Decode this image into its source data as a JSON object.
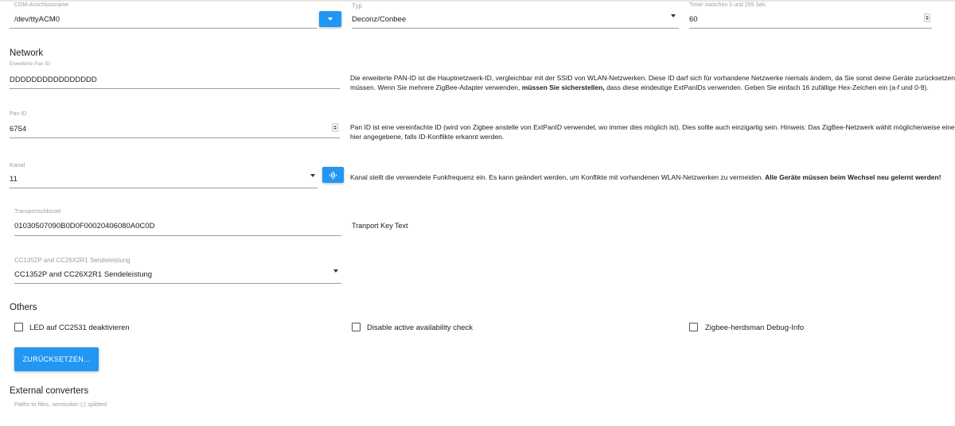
{
  "com_port": {
    "label": "COM-Anschlussname",
    "value": "/dev/ttyACM0"
  },
  "type": {
    "label": "Typ",
    "value": "Deconz/Conbee"
  },
  "timer": {
    "label": "Timer zwischen 0 und 255 Sek.",
    "value": "60"
  },
  "network": {
    "title": "Network",
    "ext_pan_id": {
      "label": "Erweiterte Pan ID",
      "value": "DDDDDDDDDDDDDDDD",
      "desc_line1": "Die erweiterte PAN-ID ist die Hauptnetzwerk-ID, vergleichbar mit der SSID von WLAN-Netzwerken. Diese ID darf sich für vorhandene Netzwerke niemals ändern, da Sie sonst deine Geräte zurücksetzen und",
      "desc_line2_pre": "müssen. Wenn Sie mehrere ZigBee-Adapter verwenden, ",
      "desc_line2_bold": "müssen Sie sicherstellen,",
      "desc_line2_post": " dass diese eindeutige ExtPanIDs verwenden. Geben Sie einfach 16 zufällige Hex-Zeichen ein (a-f und 0-9)."
    },
    "pan_id": {
      "label": "Pan ID",
      "value": "6754",
      "desc_line1": "Pan ID ist eine vereinfachte ID (wird von Zigbee anstelle von ExtPanID verwendet, wo immer dies möglich ist). Dies sollte auch einzigartig sein. Hinweis: Das ZigBee-Netzwerk wählt möglicherweise eine an",
      "desc_line2": "hier angegebene, falls ID-Konflikte erkannt werden."
    },
    "channel": {
      "label": "Kanal",
      "value": "11",
      "desc_pre": "Kanal stellt die verwendete Funkfrequenz ein. Es kann geändert werden, um Konflikte mit vorhandenen WLAN-Netzwerken zu vermeiden. ",
      "desc_bold": "Alle Geräte müssen beim Wechsel neu gelernt werden!"
    },
    "transport_key": {
      "label": "Transportschlüssel",
      "value": "01030507090B0D0F00020406080A0C0D",
      "desc": "Tranport Key Text"
    },
    "tx_power": {
      "label": "CC1352P and CC26X2R1 Sendeleistung",
      "value": "CC1352P and CC26X2R1 Sendeleistung"
    }
  },
  "others": {
    "title": "Others",
    "checkboxes": [
      {
        "label": "LED auf CC2531 deaktivieren",
        "checked": false
      },
      {
        "label": "Disable active availability check",
        "checked": false
      },
      {
        "label": "Zigbee-herdsman Debug-Info",
        "checked": false
      }
    ],
    "reset_button": "ZURÜCKSETZEN..."
  },
  "external": {
    "title": "External converters",
    "hint": "Paths to files, semicolon (;) splitted"
  },
  "colors": {
    "accent": "#2196f3",
    "line": "#9e9e9e",
    "label": "#9e9e9e",
    "text": "#212121"
  },
  "icons": {
    "com_button": "chevron-down-icon",
    "channel_button": "scan-icon"
  }
}
